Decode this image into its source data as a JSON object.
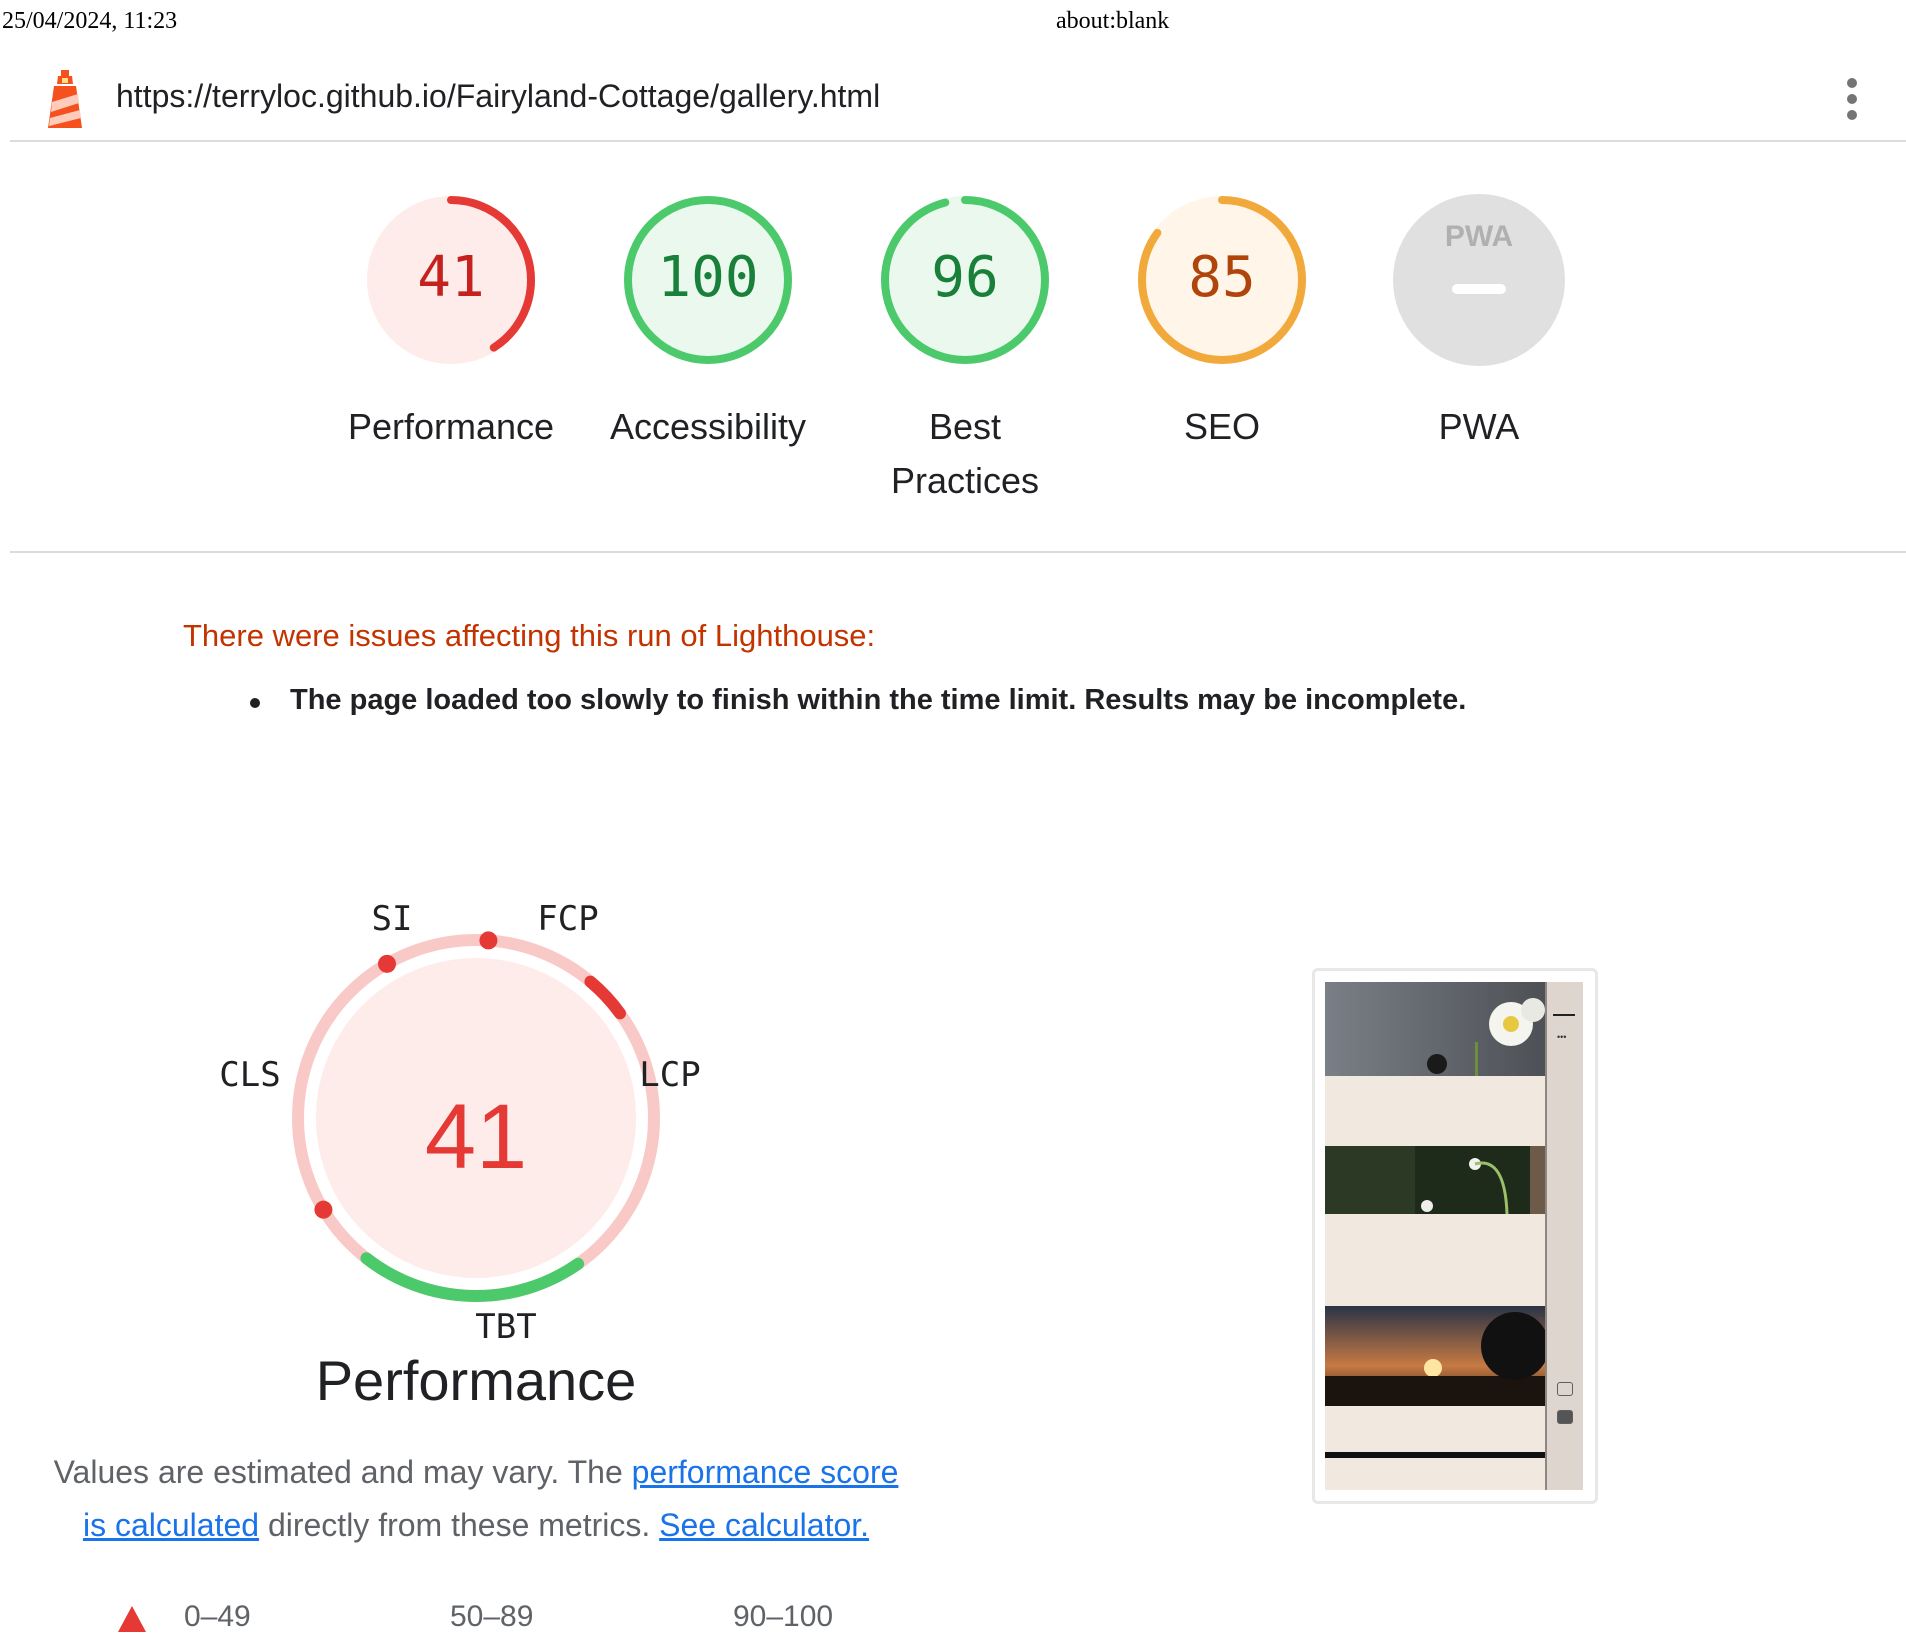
{
  "print_header": {
    "date": "25/04/2024, 11:23",
    "title": "about:blank"
  },
  "toolbar": {
    "url": "https://terryloc.github.io/Fairyland-Cottage/gallery.html",
    "menu_icon": "more-vert-icon",
    "logo_icon": "lighthouse-logo-icon"
  },
  "scores": [
    {
      "id": "performance",
      "score": 41,
      "label": "Performance",
      "color": "#e53935",
      "bg": "#fdecea",
      "text_color": "#c5221f"
    },
    {
      "id": "accessibility",
      "score": 100,
      "label": "Accessibility",
      "color": "#4cca6b",
      "bg": "#eaf8ee",
      "text_color": "#188038"
    },
    {
      "id": "best-practices",
      "score": 96,
      "label": "Best Practices",
      "color": "#4cca6b",
      "bg": "#eaf8ee",
      "text_color": "#188038"
    },
    {
      "id": "seo",
      "score": 85,
      "label": "SEO",
      "color": "#f2a93b",
      "bg": "#fff5e8",
      "text_color": "#b0450b"
    }
  ],
  "pwa": {
    "label": "PWA",
    "badge_text": "PWA",
    "bg": "#e0e0e0"
  },
  "warning": {
    "title": "There were issues affecting this run of Lighthouse:",
    "items": [
      "The page loaded too slowly to finish within the time limit. Results may be incomplete."
    ]
  },
  "performance_detail": {
    "score": "41",
    "title": "Performance",
    "metrics": {
      "si": "SI",
      "fcp": "FCP",
      "lcp": "LCP",
      "tbt": "TBT",
      "cls": "CLS"
    },
    "desc_prefix": "Values are estimated and may vary. The ",
    "link1": "performance score is calculated",
    "desc_middle": " directly from these metrics. ",
    "link2": "See calculator."
  },
  "legend": {
    "fail": "0–49",
    "average": "50–89",
    "pass": "90–100"
  }
}
